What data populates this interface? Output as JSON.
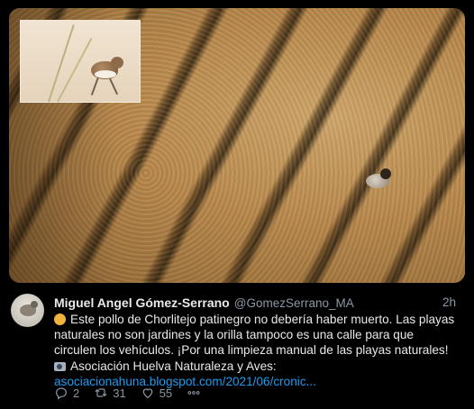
{
  "tweet": {
    "author_name": "Miguel Angel Gómez-Serrano",
    "author_handle": "@GomezSerrano_MA",
    "time": "2h",
    "lines": [
      "Este pollo de Chorlitejo patinegro no debería haber muerto. Las playas",
      "naturales no son jardines y la orilla tampoco es una calle para que",
      "circulen los vehículos. ¡Por una limpieza manual de las playas naturales!",
      "Asociación Huelva Naturaleza y Aves:"
    ],
    "link_text": "asociacionahuna.blogspot.com/2021/06/cronic...",
    "line1_emoji": "face-emoji",
    "line4_emoji": "camera-emoji"
  },
  "actions": {
    "replies": "2",
    "retweets": "31",
    "likes": "55",
    "reply_icon": "reply-icon",
    "retweet_icon": "retweet-icon",
    "like_icon": "heart-icon",
    "more_icon": "more-icon"
  },
  "colors": {
    "background": "#000000",
    "text": "#e7e9ea",
    "secondary": "#8b98a5",
    "link": "#1d9bf0"
  }
}
